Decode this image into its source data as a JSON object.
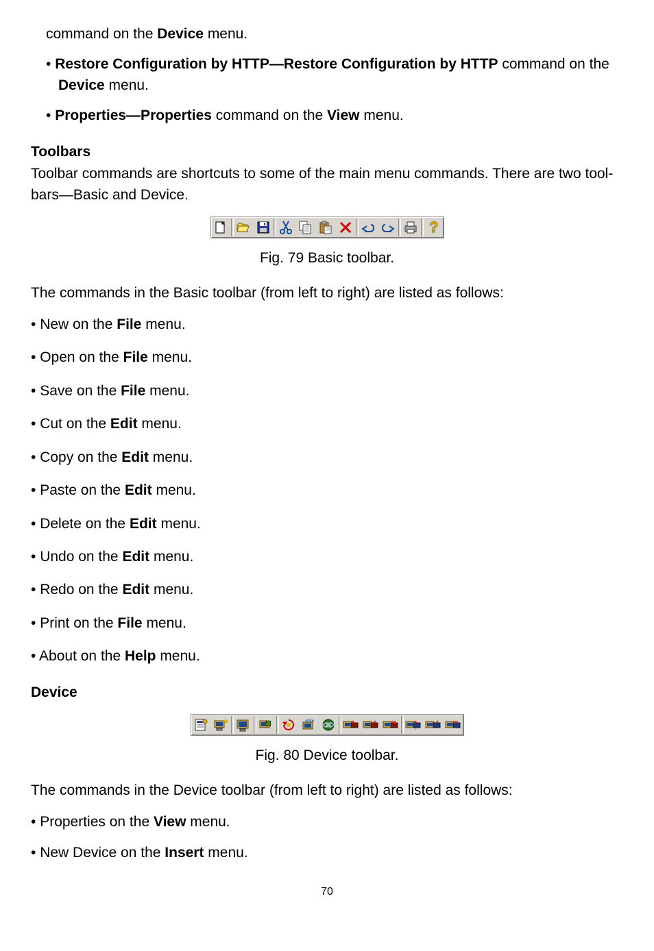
{
  "intro_line": {
    "pre": "command on the ",
    "b1": "Device",
    "post": " menu."
  },
  "top_bullets": [
    {
      "b1": "Restore Configuration by HTTP—Restore Configuration by HTTP",
      "mid": " command on the ",
      "b2": "Device",
      "post": " menu."
    },
    {
      "b1": "Properties—Properties",
      "mid": " command on the ",
      "b2": "View",
      "post": " menu."
    }
  ],
  "toolbars_heading": "Toolbars",
  "toolbars_para": "Toolbar commands are shortcuts to some of the main menu commands. There are two tool-bars—Basic and Device.",
  "fig79": "Fig. 79 Basic toolbar.",
  "basic_intro": "The commands in the Basic toolbar (from left to right) are listed as follows:",
  "basic_list": [
    {
      "pre": "New on the ",
      "b": "File",
      "post": " menu."
    },
    {
      "pre": "Open on the ",
      "b": "File",
      "post": " menu."
    },
    {
      "pre": "Save on the ",
      "b": "File",
      "post": " menu."
    },
    {
      "pre": "Cut on the ",
      "b": "Edit",
      "post": " menu."
    },
    {
      "pre": "Copy on the ",
      "b": "Edit",
      "post": " menu."
    },
    {
      "pre": "Paste on the ",
      "b": "Edit",
      "post": " menu."
    },
    {
      "pre": "Delete on the ",
      "b": "Edit",
      "post": " menu."
    },
    {
      "pre": "Undo on the ",
      "b": "Edit",
      "post": " menu."
    },
    {
      "pre": "Redo on the ",
      "b": "Edit",
      "post": " menu."
    },
    {
      "pre": "Print on the ",
      "b": "File",
      "post": " menu."
    },
    {
      "pre": "About on the ",
      "b": "Help",
      "post": " menu."
    }
  ],
  "device_heading": "Device",
  "fig80": "Fig. 80 Device toolbar.",
  "device_intro": "The commands in the Device toolbar (from left to right) are listed as follows:",
  "device_list": [
    {
      "pre": "Properties on the ",
      "b": "View",
      "post": " menu."
    },
    {
      "pre": "New Device on the ",
      "b": "Insert",
      "post": " menu."
    }
  ],
  "page_number": "70",
  "basic_toolbar_icons": [
    "new",
    "open",
    "save",
    "cut",
    "copy",
    "paste",
    "delete",
    "undo",
    "redo",
    "print",
    "help"
  ],
  "device_toolbar_icons": [
    "properties",
    "new-device",
    "monitor",
    "config",
    "restore",
    "update",
    "wireless",
    "dev-a",
    "dev-b",
    "dev-c",
    "dev-d",
    "dev-e",
    "dev-f"
  ]
}
